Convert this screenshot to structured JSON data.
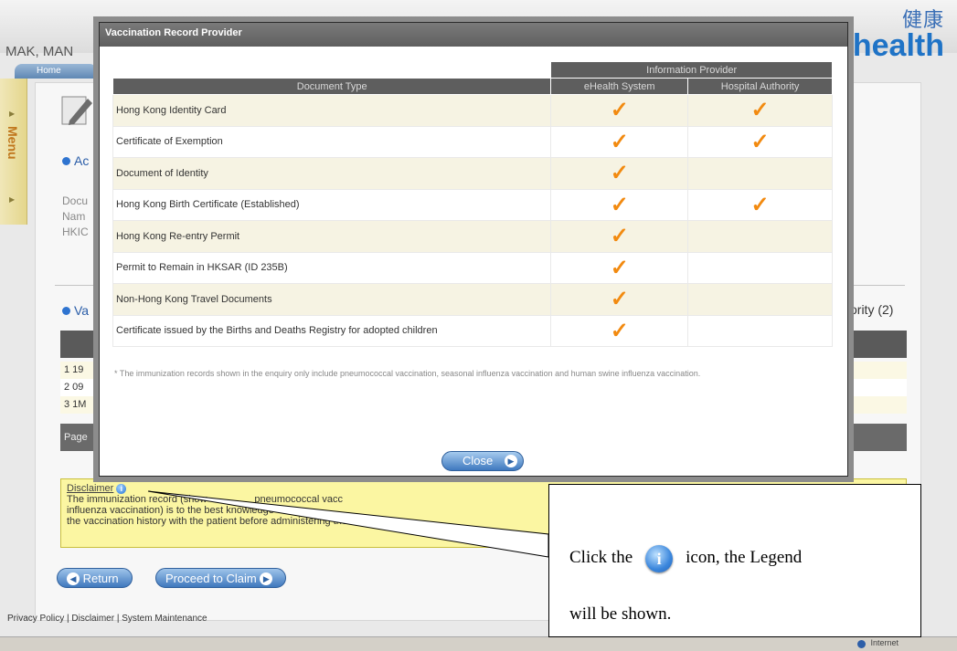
{
  "header": {
    "user_name": "MAK, MAN",
    "home_tab": "Home",
    "logo_cn": "健康",
    "logo_en": "health"
  },
  "sidebar": {
    "menu_label": "Menu"
  },
  "background": {
    "section_account": "Ac",
    "doc_lines": [
      "Docu",
      "Nam",
      "HKIC"
    ],
    "section_vaccination": "Va",
    "hospital_count": "ority (2)",
    "rows": [
      "1  19",
      "2  09",
      "3  1M"
    ],
    "page_label": "Page"
  },
  "disclaimer": {
    "title": "Disclaimer",
    "line1": "The immunization record (show",
    "line1b": "pneumococcal vacc",
    "line2": "influenza vaccination) is to the best knowledge of",
    "line3": "the vaccination history with the patient before administering the vacc"
  },
  "buttons": {
    "return": "Return",
    "proceed": "Proceed to Claim"
  },
  "footer": {
    "links": "Privacy Policy | Disclaimer | System Maintenance"
  },
  "statusbar": {
    "zone": "Internet"
  },
  "modal": {
    "title": "Vaccination Record Provider",
    "group_header": "Information Provider",
    "col_doc": "Document Type",
    "col_ehealth": "eHealth System",
    "col_ha": "Hospital Authority",
    "rows": [
      {
        "doc": "Hong Kong Identity Card",
        "ehealth": true,
        "ha": true
      },
      {
        "doc": "Certificate of Exemption",
        "ehealth": true,
        "ha": true
      },
      {
        "doc": "Document of Identity",
        "ehealth": true,
        "ha": false
      },
      {
        "doc": "Hong Kong Birth Certificate (Established)",
        "ehealth": true,
        "ha": true
      },
      {
        "doc": "Hong Kong Re-entry Permit",
        "ehealth": true,
        "ha": false
      },
      {
        "doc": "Permit to Remain in HKSAR (ID 235B)",
        "ehealth": true,
        "ha": false
      },
      {
        "doc": "Non-Hong Kong Travel Documents",
        "ehealth": true,
        "ha": false
      },
      {
        "doc": "Certificate issued by the Births and Deaths Registry for adopted children",
        "ehealth": true,
        "ha": false
      }
    ],
    "note": "* The immunization records shown in the enquiry only include pneumococcal vaccination, seasonal influenza vaccination and human swine influenza vaccination.",
    "close_label": "Close",
    "check_glyph": "✓"
  },
  "callout": {
    "line1_before": "Click the",
    "icon_glyph": "i",
    "line1_after": "icon, the Legend",
    "line2": "will be shown."
  }
}
